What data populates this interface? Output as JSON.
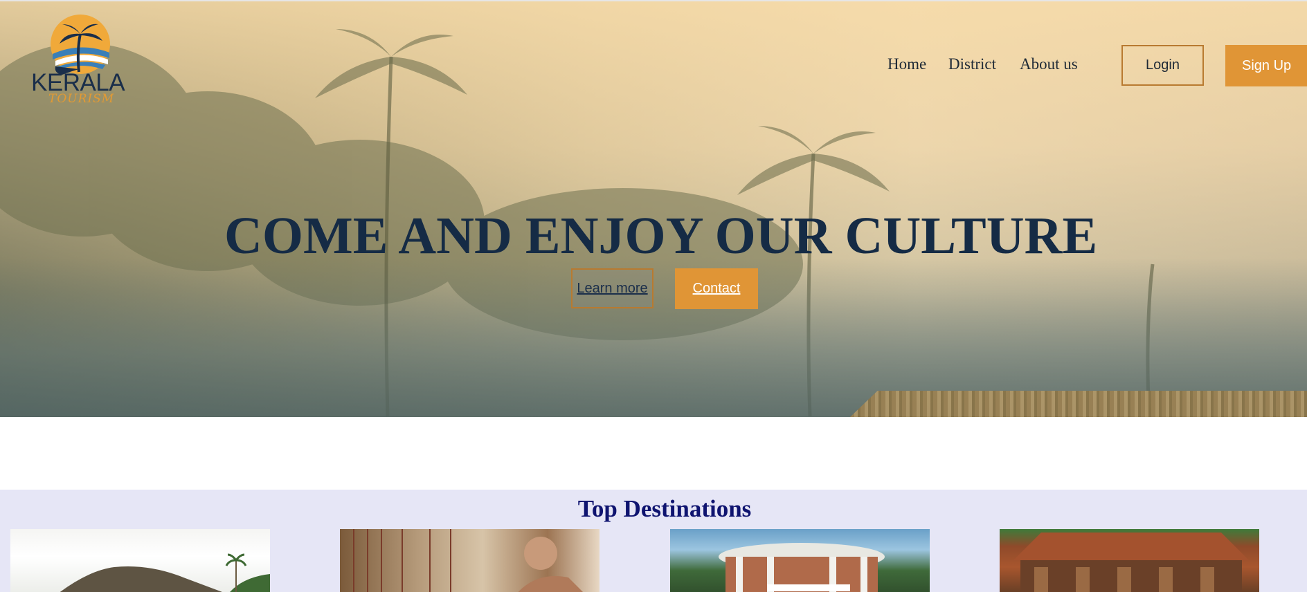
{
  "brand": {
    "name": "KERALA",
    "tagline": "TOURISM",
    "colors": {
      "navy": "#152b45",
      "orange": "#e09536",
      "purple_heading": "#0f1470",
      "section_bg": "#e6e6f6"
    }
  },
  "nav": {
    "items": [
      {
        "label": "Home"
      },
      {
        "label": "District"
      },
      {
        "label": "About us"
      }
    ],
    "login_label": "Login",
    "signup_label": "Sign Up"
  },
  "hero": {
    "headline": "COME AND ENJOY OUR CULTURE",
    "learn_more_label": "Learn more",
    "contact_label": "Contact"
  },
  "destinations": {
    "title": "Top Destinations",
    "cards": [
      {
        "image": "hill-landscape"
      },
      {
        "image": "weaver-at-loom"
      },
      {
        "image": "museum-building"
      },
      {
        "image": "traditional-wooden-house"
      }
    ]
  }
}
